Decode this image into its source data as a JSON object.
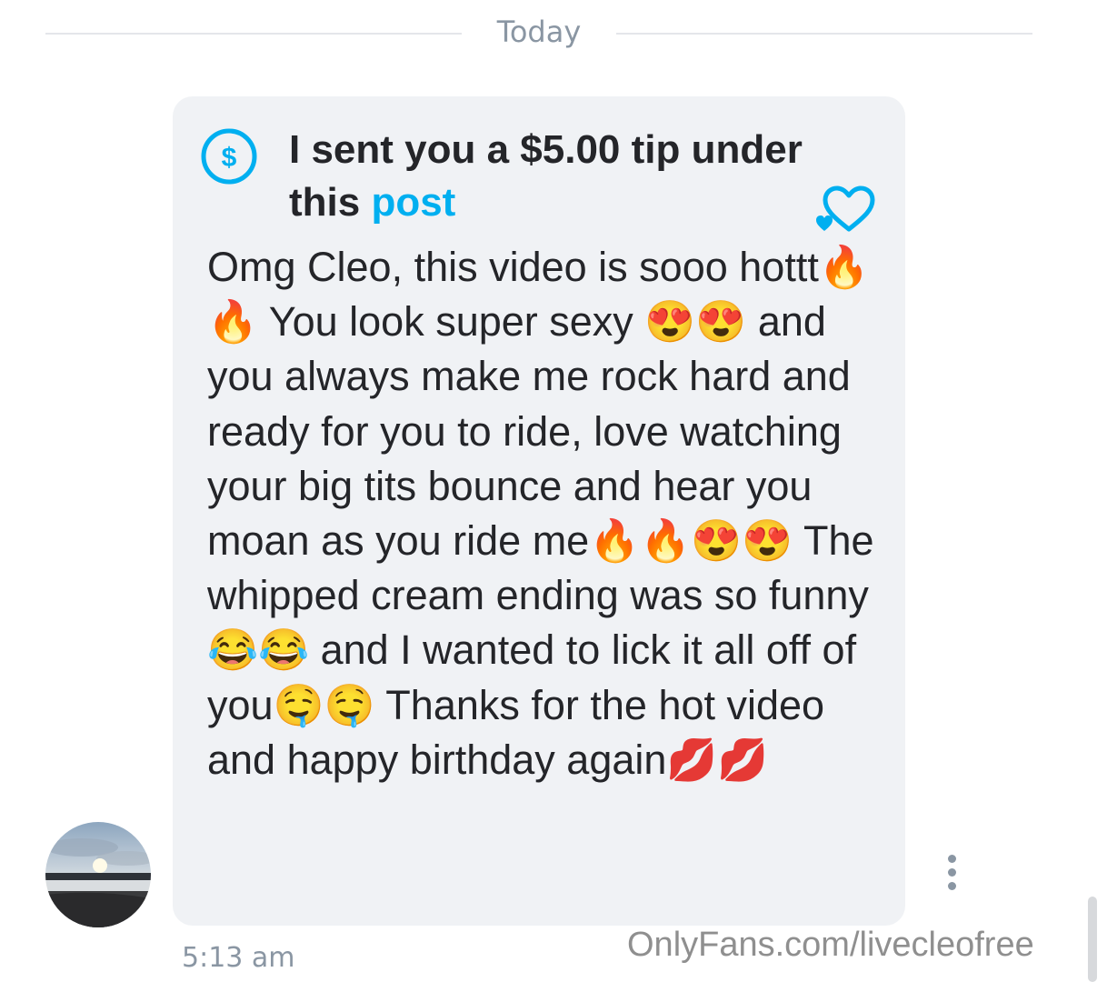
{
  "date_divider": {
    "label": "Today"
  },
  "message": {
    "tip_icon": "dollar-circle-icon",
    "tip_text_prefix": "I sent you a $5.00 tip under this ",
    "tip_link_text": "post",
    "like_icon": "heart-outline-icon",
    "body": "Omg Cleo, this video is sooo hottt🔥🔥 You look super sexy 😍😍 and you always make me rock hard and ready for you to ride, love watching your big tits bounce and hear you moan as you ride me🔥🔥😍😍 The whipped cream ending was so funny😂😂 and I wanted to lick it all off of you🤤🤤 Thanks for the hot video and happy birthday again💋💋",
    "time": "5:13 am"
  },
  "avatar": {
    "icon": "user-avatar"
  },
  "menu": {
    "icon": "more-vertical-icon"
  },
  "watermark": {
    "text": "OnlyFans.com/livecleofree"
  },
  "colors": {
    "accent": "#00aff0",
    "bubble": "#f0f2f5",
    "text": "#242529",
    "muted": "#8a96a3"
  }
}
